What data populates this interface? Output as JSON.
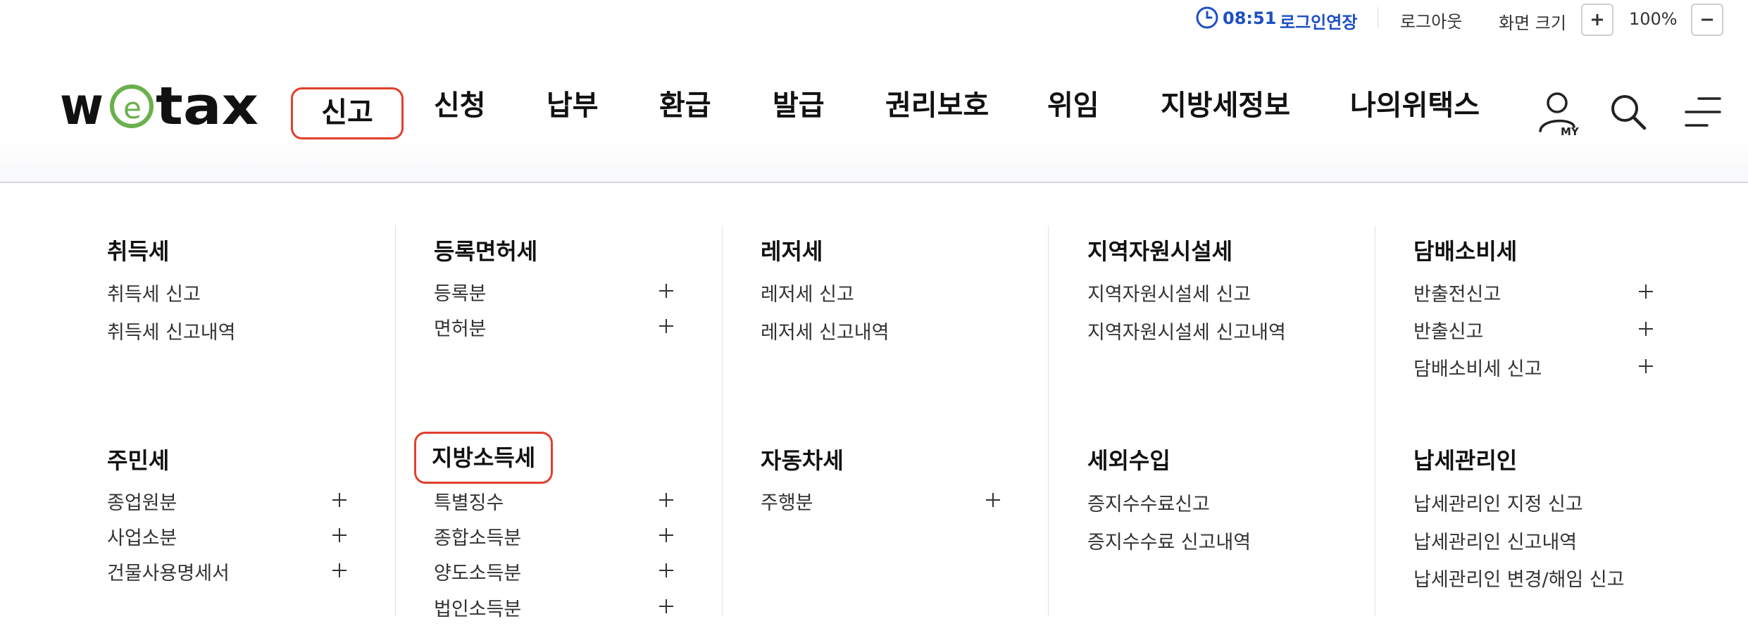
{
  "utility": {
    "timer": "08:51",
    "extend_login": "로그인연장",
    "logout": "로그아웃",
    "zoom_label": "화면 크기",
    "zoom_value": "100%"
  },
  "logo": {
    "text": "wetax"
  },
  "nav": [
    "신고",
    "신청",
    "납부",
    "환급",
    "발급",
    "권리보호",
    "위임",
    "지방세정보",
    "나의위택스"
  ],
  "nav_active_index": 0,
  "header_icons": [
    "my-page-icon",
    "search-icon",
    "hamburger-menu-icon"
  ],
  "header_icon_badge": "MY",
  "menu": {
    "acquisition": {
      "title": "취득세",
      "items": [
        "취득세 신고",
        "취득세 신고내역"
      ]
    },
    "registration": {
      "title": "등록면허세",
      "items": [
        "등록분",
        "면허분"
      ]
    },
    "leisure": {
      "title": "레저세",
      "items": [
        "레저세 신고",
        "레저세 신고내역"
      ]
    },
    "regional_resource": {
      "title": "지역자원시설세",
      "items": [
        "지역자원시설세 신고",
        "지역자원시설세 신고내역"
      ]
    },
    "tobacco": {
      "title": "담배소비세",
      "items": [
        "반출전신고",
        "반출신고",
        "담배소비세 신고"
      ]
    },
    "resident": {
      "title": "주민세",
      "items": [
        "종업원분",
        "사업소분",
        "건물사용명세서"
      ]
    },
    "local_income": {
      "title": "지방소득세",
      "items": [
        "특별징수",
        "종합소득분",
        "양도소득분",
        "법인소득분"
      ]
    },
    "vehicle": {
      "title": "자동차세",
      "items": [
        "주행분"
      ]
    },
    "non_tax": {
      "title": "세외수입",
      "items": [
        "증지수수료신고",
        "증지수수료 신고내역"
      ]
    },
    "tax_agent": {
      "title": "납세관리인",
      "items": [
        "납세관리인 지정 신고",
        "납세관리인 신고내역",
        "납세관리인 변경/해임 신고"
      ]
    }
  },
  "colors": {
    "accent_blue": "#1d4fc4",
    "highlight_red": "#e0402d",
    "logo_green": "#6ab04c",
    "text_dark": "#111111"
  }
}
